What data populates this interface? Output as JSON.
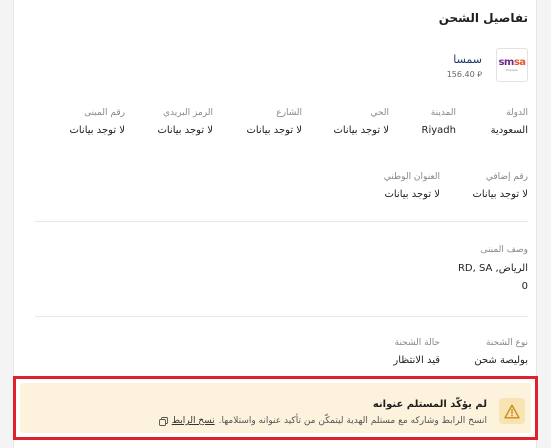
{
  "section": {
    "title": "تفاصيل الشحن"
  },
  "carrier": {
    "logo_text_primary": "sm",
    "logo_text_secondary": "sa",
    "logo_sub": "Express",
    "name": "سمسا",
    "price": "156.40",
    "currency_icon": "riyal-icon"
  },
  "address_row1": [
    {
      "label": "الدولة",
      "value": "السعودية"
    },
    {
      "label": "المدينة",
      "value": "Riyadh"
    },
    {
      "label": "الحي",
      "value": "لا توجد بيانات"
    },
    {
      "label": "الشارع",
      "value": "لا توجد بيانات"
    },
    {
      "label": "الرمز البريدي",
      "value": "لا توجد بيانات"
    },
    {
      "label": "رقم المبنى",
      "value": "لا توجد بيانات"
    }
  ],
  "address_row2": [
    {
      "label": "رقم إضافي",
      "value": "لا توجد بيانات"
    },
    {
      "label": "العنوان الوطني",
      "value": "لا توجد بيانات"
    }
  ],
  "building_description": {
    "label": "وصف المبنى",
    "line1": "الرياض, RD, SA",
    "line2": "0"
  },
  "shipment": [
    {
      "label": "نوع الشحنة",
      "value": "بوليصة شحن"
    },
    {
      "label": "حالة الشحنة",
      "value": "قيد الانتظار"
    }
  ],
  "warning": {
    "title": "لم يؤكّد المستلم عنوانه",
    "description": "انسخ الرابط وشاركه مع مستلم الهدية ليتمكّن من تأكيد عنوانه واستلامها.",
    "copy_link_label": "نسخ الرابط",
    "icon": "warning-triangle-icon",
    "accent_color": "#e0202a"
  }
}
